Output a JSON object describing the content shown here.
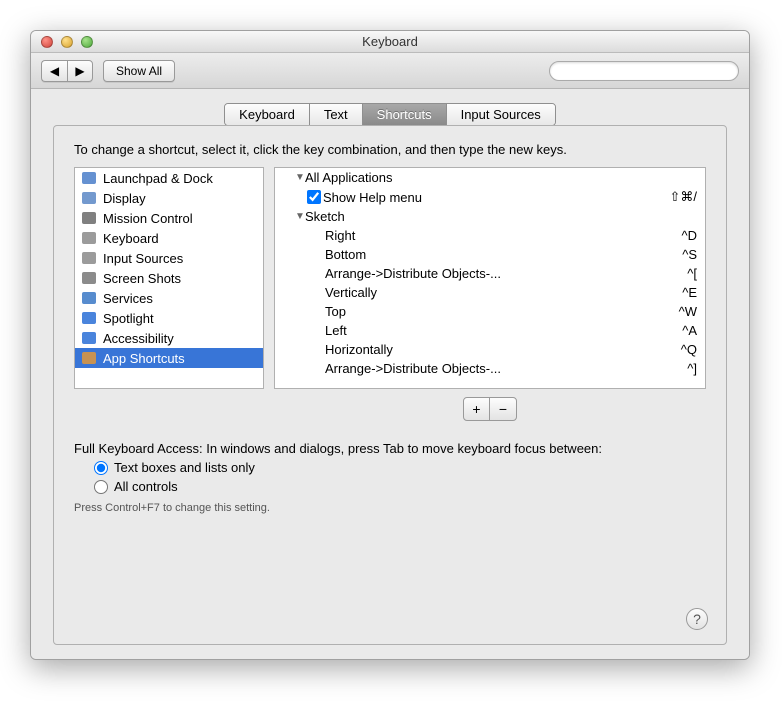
{
  "window": {
    "title": "Keyboard"
  },
  "toolbar": {
    "back_glyph": "◀",
    "fwd_glyph": "▶",
    "show_all_label": "Show All",
    "search_placeholder": ""
  },
  "tabs": [
    {
      "label": "Keyboard",
      "selected": false
    },
    {
      "label": "Text",
      "selected": false
    },
    {
      "label": "Shortcuts",
      "selected": true
    },
    {
      "label": "Input Sources",
      "selected": false
    }
  ],
  "instructions": "To change a shortcut, select it, click the key combination, and then type the new keys.",
  "categories": [
    {
      "label": "Launchpad & Dock",
      "icon": "launchpad",
      "color": "#4a7ec9"
    },
    {
      "label": "Display",
      "icon": "display",
      "color": "#5b87c5"
    },
    {
      "label": "Mission Control",
      "icon": "mission",
      "color": "#6a6a6a"
    },
    {
      "label": "Keyboard",
      "icon": "keyboard",
      "color": "#8a8a8a"
    },
    {
      "label": "Input Sources",
      "icon": "input",
      "color": "#8a8a8a"
    },
    {
      "label": "Screen Shots",
      "icon": "screenshot",
      "color": "#777"
    },
    {
      "label": "Services",
      "icon": "services",
      "color": "#3a78c5"
    },
    {
      "label": "Spotlight",
      "icon": "spotlight",
      "color": "#2a6fd6"
    },
    {
      "label": "Accessibility",
      "icon": "accessibility",
      "color": "#2a6fd6"
    },
    {
      "label": "App Shortcuts",
      "icon": "app",
      "color": "#e0983a",
      "selected": true
    }
  ],
  "tree": {
    "groups": [
      {
        "label": "All Applications",
        "items": [
          {
            "label": "Show Help menu",
            "key": "⇧⌘/",
            "checked": true
          }
        ]
      },
      {
        "label": "Sketch",
        "items": [
          {
            "label": "Right",
            "key": "^D"
          },
          {
            "label": "Bottom",
            "key": "^S"
          },
          {
            "label": "Arrange->Distribute Objects-...",
            "key": "^["
          },
          {
            "label": "Vertically",
            "key": "^E"
          },
          {
            "label": "Top",
            "key": "^W"
          },
          {
            "label": "Left",
            "key": "^A"
          },
          {
            "label": "Horizontally",
            "key": "^Q"
          },
          {
            "label": "Arrange->Distribute Objects-...",
            "key": "^]"
          }
        ]
      }
    ]
  },
  "buttons": {
    "add": "+",
    "remove": "−"
  },
  "access": {
    "heading": "Full Keyboard Access: In windows and dialogs, press Tab to move keyboard focus between:",
    "options": [
      {
        "label": "Text boxes and lists only",
        "selected": true
      },
      {
        "label": "All controls",
        "selected": false
      }
    ],
    "hint": "Press Control+F7 to change this setting."
  },
  "help_glyph": "?"
}
